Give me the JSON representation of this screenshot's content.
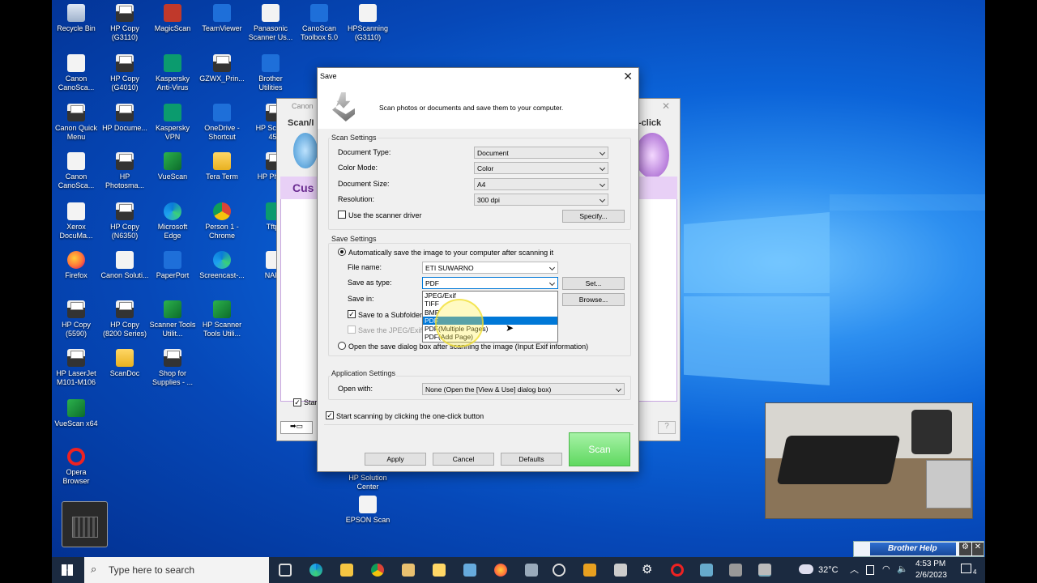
{
  "desktop": {
    "icons": [
      {
        "label": "Recycle Bin",
        "icon": "recycle-bin-icon",
        "kind": "recycle"
      },
      {
        "label": "HP Copy (G3110)",
        "icon": "printer-icon",
        "kind": "printer"
      },
      {
        "label": "MagicScan",
        "icon": "scanner-icon",
        "kind": "red"
      },
      {
        "label": "TeamViewer",
        "icon": "teamviewer-icon",
        "kind": "blue"
      },
      {
        "label": "Panasonic Scanner Us...",
        "icon": "scanner-icon",
        "kind": "white"
      },
      {
        "label": "CanoScan Toolbox 5.0",
        "icon": "scanner-icon",
        "kind": "blue"
      },
      {
        "label": "HPScanning (G3110)",
        "icon": "scanner-icon",
        "kind": "white"
      },
      {
        "label": "Canon CanoSca...",
        "icon": "document-icon",
        "kind": "white"
      },
      {
        "label": "HP Copy (G4010)",
        "icon": "printer-icon",
        "kind": "printer"
      },
      {
        "label": "Kaspersky Anti-Virus",
        "icon": "kaspersky-icon",
        "kind": "kasper"
      },
      {
        "label": "GZWX_Prin...",
        "icon": "app-icon",
        "kind": "printer"
      },
      {
        "label": "Brother Utilities",
        "icon": "brother-icon",
        "kind": "blue"
      },
      {
        "label": "Canon Quick Menu",
        "icon": "app-icon",
        "kind": "printer"
      },
      {
        "label": "HP Docume...",
        "icon": "scanner-icon",
        "kind": "printer"
      },
      {
        "label": "Kaspersky VPN",
        "icon": "kaspersky-icon",
        "kind": "kasper"
      },
      {
        "label": "OneDrive - Shortcut",
        "icon": "onedrive-icon",
        "kind": "blue"
      },
      {
        "label": "Canon CanoSca...",
        "icon": "document-icon",
        "kind": "white"
      },
      {
        "label": "HP Photosma...",
        "icon": "printer-icon",
        "kind": "printer"
      },
      {
        "label": "VueScan",
        "icon": "scanner-icon",
        "kind": "scanner"
      },
      {
        "label": "Tera Term",
        "icon": "terminal-icon",
        "kind": "folder"
      },
      {
        "label": "Xerox DocuMa...",
        "icon": "document-icon",
        "kind": "white"
      },
      {
        "label": "HP Copy (N6350)",
        "icon": "printer-icon",
        "kind": "printer"
      },
      {
        "label": "Microsoft Edge",
        "icon": "edge-icon",
        "kind": "edge"
      },
      {
        "label": "Person 1 - Chrome",
        "icon": "chrome-icon",
        "kind": "chrome"
      },
      {
        "label": "Firefox",
        "icon": "firefox-icon",
        "kind": "firefox"
      },
      {
        "label": "Canon Soluti...",
        "icon": "scanner-icon",
        "kind": "white"
      },
      {
        "label": "PaperPort",
        "icon": "paperport-icon",
        "kind": "blue"
      },
      {
        "label": "Screencast-...",
        "icon": "screencast-icon",
        "kind": "edge"
      },
      {
        "label": "HP Copy (5590)",
        "icon": "printer-icon",
        "kind": "printer"
      },
      {
        "label": "HP Copy (8200 Series)",
        "icon": "printer-icon",
        "kind": "printer"
      },
      {
        "label": "Scanner Tools Utilit...",
        "icon": "scanner-icon",
        "kind": "scanner"
      },
      {
        "label": "HP Scanner Tools Utili...",
        "icon": "scanner-icon",
        "kind": "scanner"
      },
      {
        "label": "HP LaserJet M101-M106",
        "icon": "printer-icon",
        "kind": "printer"
      },
      {
        "label": "ScanDoc",
        "icon": "folder-icon",
        "kind": "folder"
      },
      {
        "label": "Shop for Supplies - ...",
        "icon": "printer-icon",
        "kind": "printer"
      },
      {
        "label": "VueScan x64",
        "icon": "scanner-icon",
        "kind": "scanner"
      },
      {
        "label": "Opera Browser",
        "icon": "opera-icon",
        "kind": "opera"
      },
      {
        "label": "HP Solution Center",
        "icon": "printer-icon",
        "kind": "printer"
      },
      {
        "label": "EPSON Scan",
        "icon": "scanner-icon",
        "kind": "white"
      }
    ],
    "partial_labels": {
      "col7_r2": "HP Sca Pro 450",
      "col7_r3": "HP Photos",
      "col7_r4": "Tftpd",
      "col7_r5": "NAPS"
    }
  },
  "bg_window": {
    "title": "Canon",
    "left_label": "Scan/I",
    "right_label": "-click",
    "tab": "Cus",
    "checkbox_label": "Star"
  },
  "dialog": {
    "title": "Save",
    "header_text": "Scan photos or documents and save them to your computer.",
    "scan_settings": {
      "group_label": "Scan Settings",
      "document_type_label": "Document Type:",
      "document_type_value": "Document",
      "color_mode_label": "Color Mode:",
      "color_mode_value": "Color",
      "document_size_label": "Document Size:",
      "document_size_value": "A4",
      "resolution_label": "Resolution:",
      "resolution_value": "300 dpi",
      "use_driver_label": "Use the scanner driver",
      "specify_button": "Specify..."
    },
    "save_settings": {
      "group_label": "Save Settings",
      "auto_save_label": "Automatically save the image to your computer after scanning it",
      "file_name_label": "File name:",
      "file_name_value": "ETI SUWARNO",
      "save_as_type_label": "Save as type:",
      "save_as_type_value": "PDF",
      "set_button": "Set...",
      "save_in_label": "Save in:",
      "browse_button": "Browse...",
      "subfolder_label": "Save to a Subfolder",
      "jpeg_exif_label": "Save the JPEG/Exif",
      "open_dialog_label": "Open the save dialog box after scanning the image (Input Exif information)",
      "type_options": [
        "JPEG/Exif",
        "TIFF",
        "BMP",
        "PDF",
        "PDF(Multiple Pages)",
        "PDF(Add Page)"
      ],
      "selected_option_index": 3
    },
    "app_settings": {
      "group_label": "Application Settings",
      "open_with_label": "Open with:",
      "open_with_value": "None (Open the [View & Use] dialog box)"
    },
    "start_label": "Start scanning by clicking the one-click button",
    "buttons": {
      "apply": "Apply",
      "cancel": "Cancel",
      "defaults": "Defaults",
      "scan": "Scan"
    }
  },
  "overlay": {
    "brother_help": "Brother Help"
  },
  "taskbar": {
    "search_placeholder": "Type here to search",
    "temperature": "32°C",
    "time": "4:53 PM",
    "date": "2/6/2023",
    "notifications": "4"
  }
}
